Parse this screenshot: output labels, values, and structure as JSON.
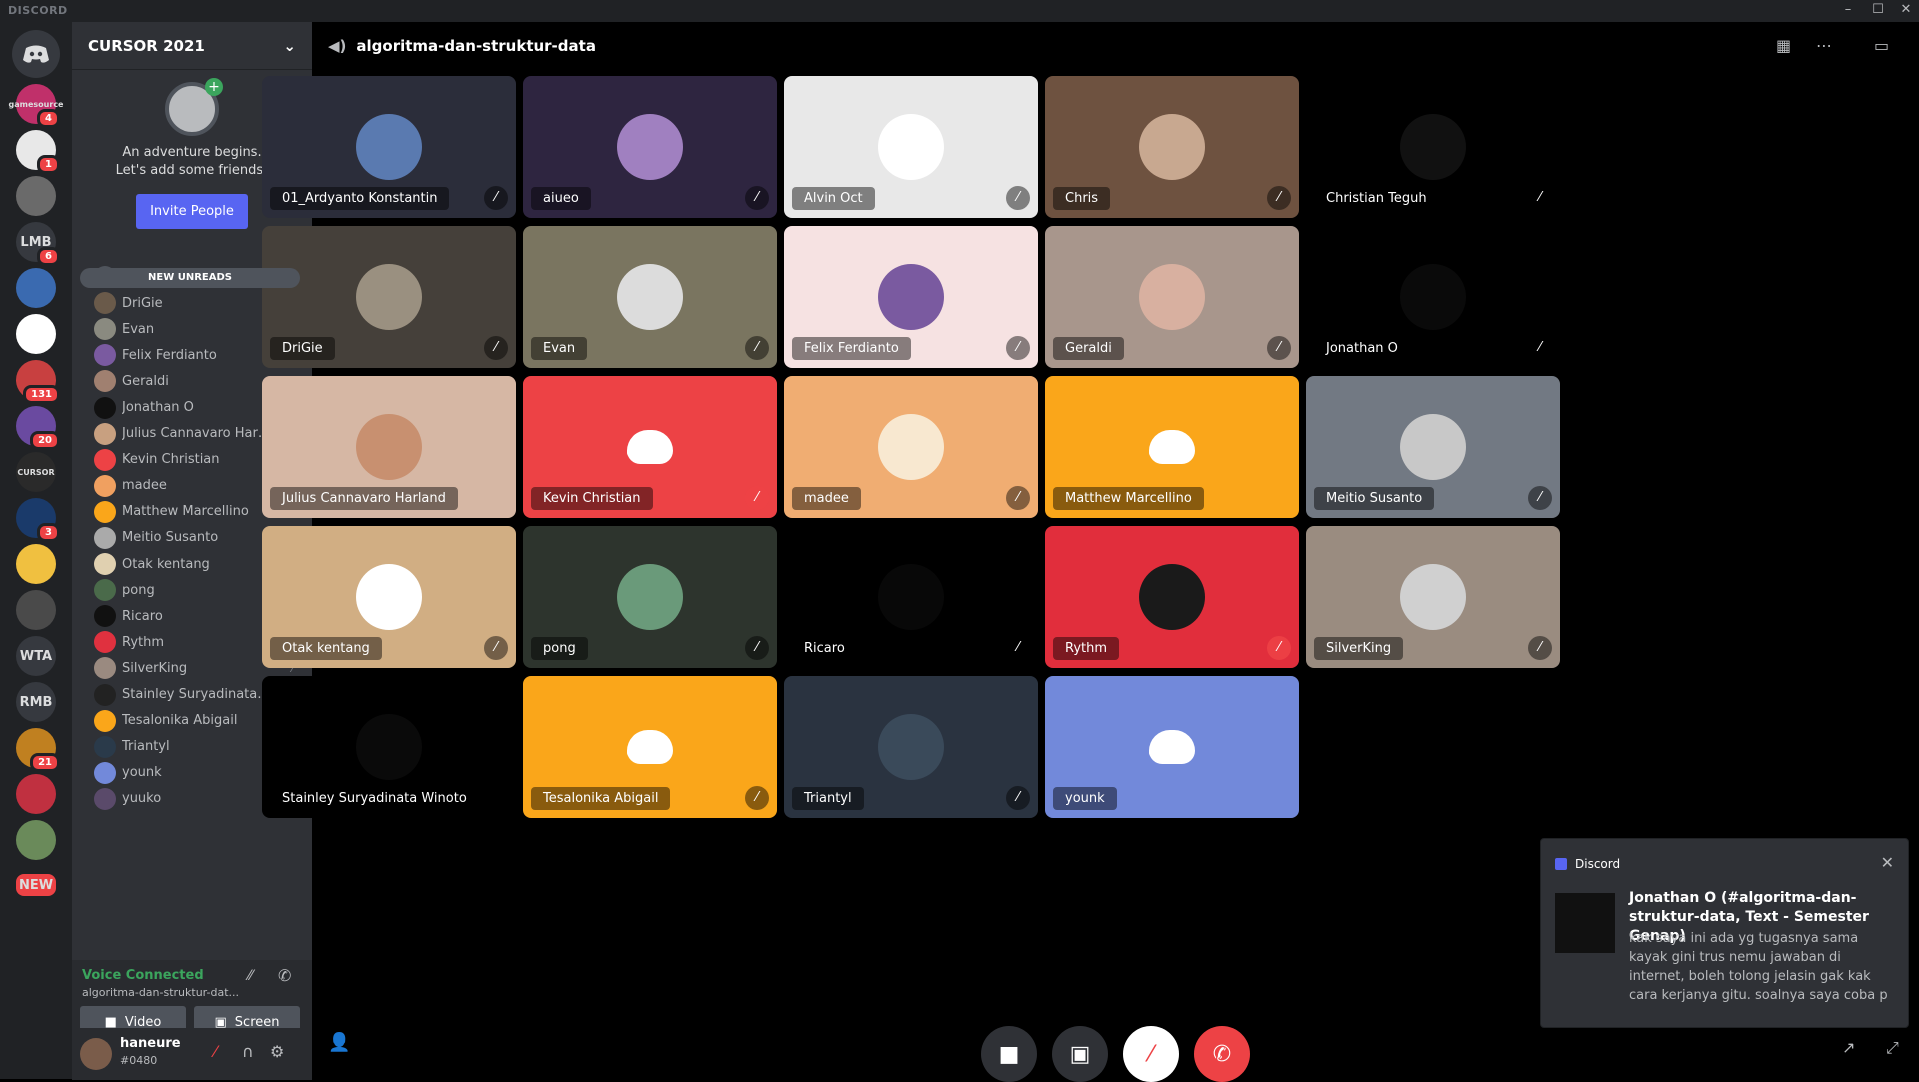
{
  "window": {
    "brand": "DISCORD",
    "minimize": "–",
    "maximize": "☐",
    "close": "✕"
  },
  "guilds": [
    {
      "label": "gamesource",
      "badge": "4"
    },
    {
      "label": "",
      "badge": "1"
    },
    {
      "label": "",
      "badge": ""
    },
    {
      "label": "LMB",
      "badge": "6"
    },
    {
      "label": "",
      "badge": ""
    },
    {
      "label": "",
      "badge": ""
    },
    {
      "label": "",
      "badge": "131"
    },
    {
      "label": "",
      "badge": "20"
    },
    {
      "label": "CURSOR",
      "badge": ""
    },
    {
      "label": "",
      "badge": "3"
    },
    {
      "label": "",
      "badge": ""
    },
    {
      "label": "",
      "badge": ""
    },
    {
      "label": "WTA",
      "badge": ""
    },
    {
      "label": "RMB",
      "badge": ""
    },
    {
      "label": "",
      "badge": "21"
    },
    {
      "label": "",
      "badge": ""
    },
    {
      "label": "",
      "badge": ""
    },
    {
      "label": "NEW",
      "badge": ""
    }
  ],
  "server": {
    "name": "CURSOR 2021",
    "chevron": "⌄"
  },
  "invite_card": {
    "line1": "An adventure begins.",
    "line2": "Let's add some friends!",
    "button": "Invite People",
    "close": "✕"
  },
  "new_unreads": "NEW UNREADS",
  "members": [
    {
      "name": "Christian Teguh",
      "color": "#4f545c",
      "muted": true
    },
    {
      "name": "DriGie",
      "color": "#6a5a4a",
      "muted": true
    },
    {
      "name": "Evan",
      "color": "#8a8a80",
      "muted": true
    },
    {
      "name": "Felix Ferdianto",
      "color": "#7a5aa0",
      "muted": true
    },
    {
      "name": "Geraldi",
      "color": "#a08070",
      "muted": true
    },
    {
      "name": "Jonathan O",
      "color": "#111111",
      "muted": true
    },
    {
      "name": "Julius Cannavaro Harland",
      "color": "#c8a080",
      "muted": false
    },
    {
      "name": "Kevin Christian",
      "color": "#ed4245",
      "muted": true
    },
    {
      "name": "madee",
      "color": "#f0a060",
      "muted": true
    },
    {
      "name": "Matthew Marcellino",
      "color": "#faa61a",
      "muted": false
    },
    {
      "name": "Meitio Susanto",
      "color": "#aaaaaa",
      "muted": true
    },
    {
      "name": "Otak kentang",
      "color": "#e0d0b0",
      "muted": true
    },
    {
      "name": "pong",
      "color": "#4a6a4a",
      "muted": true
    },
    {
      "name": "Ricaro",
      "color": "#111111",
      "muted": true
    },
    {
      "name": "Rythm",
      "color": "#e0313f",
      "muted": true
    },
    {
      "name": "SilverKing",
      "color": "#9a8a80",
      "muted": true
    },
    {
      "name": "Stainley Suryadinata Wi...",
      "color": "#222222",
      "muted": false
    },
    {
      "name": "Tesalonika Abigail",
      "color": "#faa61a",
      "muted": true
    },
    {
      "name": "Triantyl",
      "color": "#2a3a4a",
      "muted": true
    },
    {
      "name": "younk",
      "color": "#7289da",
      "muted": true
    },
    {
      "name": "yuuko",
      "color": "#5a4a6a",
      "muted": true
    }
  ],
  "voice": {
    "status": "Voice Connected",
    "channel": "algoritma-dan-struktur-dat...",
    "video": "Video",
    "screen": "Screen"
  },
  "user": {
    "name": "haneure",
    "tag": "#0480"
  },
  "channel": {
    "name": "algoritma-dan-struktur-data"
  },
  "tiles": [
    {
      "name": "01_Ardyanto Konstantin",
      "bg": "#2b2d3a",
      "av": "#5a7ab0",
      "mic": "muted"
    },
    {
      "name": "aiueo",
      "bg": "#2e2540",
      "av": "#a080c0",
      "mic": "muted"
    },
    {
      "name": "Alvin Oct",
      "bg": "#e8e8e8",
      "av": "#ffffff",
      "mic": "muted"
    },
    {
      "name": "Chris",
      "bg": "#6e5240",
      "av": "#c8a890",
      "mic": "muted"
    },
    {
      "name": "Christian Teguh",
      "bg": "#000000",
      "av": "#111111",
      "mic": "muted"
    },
    {
      "name": "DriGie",
      "bg": "#45403a",
      "av": "#9a9080",
      "mic": "muted"
    },
    {
      "name": "Evan",
      "bg": "#7a7560",
      "av": "#dcdcdc",
      "mic": "muted"
    },
    {
      "name": "Felix Ferdianto",
      "bg": "#f6e2e2",
      "av": "#7a5aa0",
      "mic": "muted"
    },
    {
      "name": "Geraldi",
      "bg": "#a8968c",
      "av": "#d8b0a0",
      "mic": "muted"
    },
    {
      "name": "Jonathan O",
      "bg": "#000000",
      "av": "#0a0a0a",
      "mic": "muted"
    },
    {
      "name": "Julius Cannavaro Harland",
      "bg": "#d6b7a4",
      "av": "#c89070",
      "mic": "none"
    },
    {
      "name": "Kevin Christian",
      "bg": "#ed4245",
      "av": "",
      "mic": "muted-red"
    },
    {
      "name": "madee",
      "bg": "#f0ad72",
      "av": "#f8e8d0",
      "mic": "muted"
    },
    {
      "name": "Matthew Marcellino",
      "bg": "#faa61a",
      "av": "",
      "mic": "none"
    },
    {
      "name": "Meitio Susanto",
      "bg": "#727983",
      "av": "#c8c8c8",
      "mic": "muted"
    },
    {
      "name": "Otak kentang",
      "bg": "#d1ae83",
      "av": "#ffffff",
      "mic": "muted"
    },
    {
      "name": "pong",
      "bg": "#2d342d",
      "av": "#6a9a7a",
      "mic": "muted"
    },
    {
      "name": "Ricaro",
      "bg": "#000000",
      "av": "#080808",
      "mic": "muted"
    },
    {
      "name": "Rythm",
      "bg": "#e12e3c",
      "av": "#1a1a1a",
      "mic": "muted-red"
    },
    {
      "name": "SilverKing",
      "bg": "#9a8c80",
      "av": "#d0d0d0",
      "mic": "muted"
    },
    {
      "name": "Stainley Suryadinata Winoto",
      "bg": "#000000",
      "av": "#0a0a0a",
      "mic": "none"
    },
    {
      "name": "Tesalonika Abigail",
      "bg": "#faa61a",
      "av": "",
      "mic": "muted"
    },
    {
      "name": "Triantyl",
      "bg": "#2a3340",
      "av": "#3a4a5a",
      "mic": "muted"
    },
    {
      "name": "younk",
      "bg": "#7289da",
      "av": "",
      "mic": "none"
    }
  ],
  "notification": {
    "app": "Discord",
    "close": "✕",
    "title": "Jonathan O (#algoritma-dan-struktur-data, Text - Semester Genap)",
    "body": "kak saya ini ada yg tugasnya sama kayak gini trus nemu jawaban di internet, boleh tolong jelasin gak kak cara kerjanya gitu. soalnya saya coba p"
  },
  "icons": {
    "speaker": "🔊",
    "mic_muted": "🎙",
    "camera": "📹",
    "screen": "🖥",
    "hangup": "✆",
    "more": "⋯",
    "grid": "▦",
    "popout": "⧉",
    "headphones": "🎧",
    "gear": "⚙",
    "add_user": "👤+"
  }
}
